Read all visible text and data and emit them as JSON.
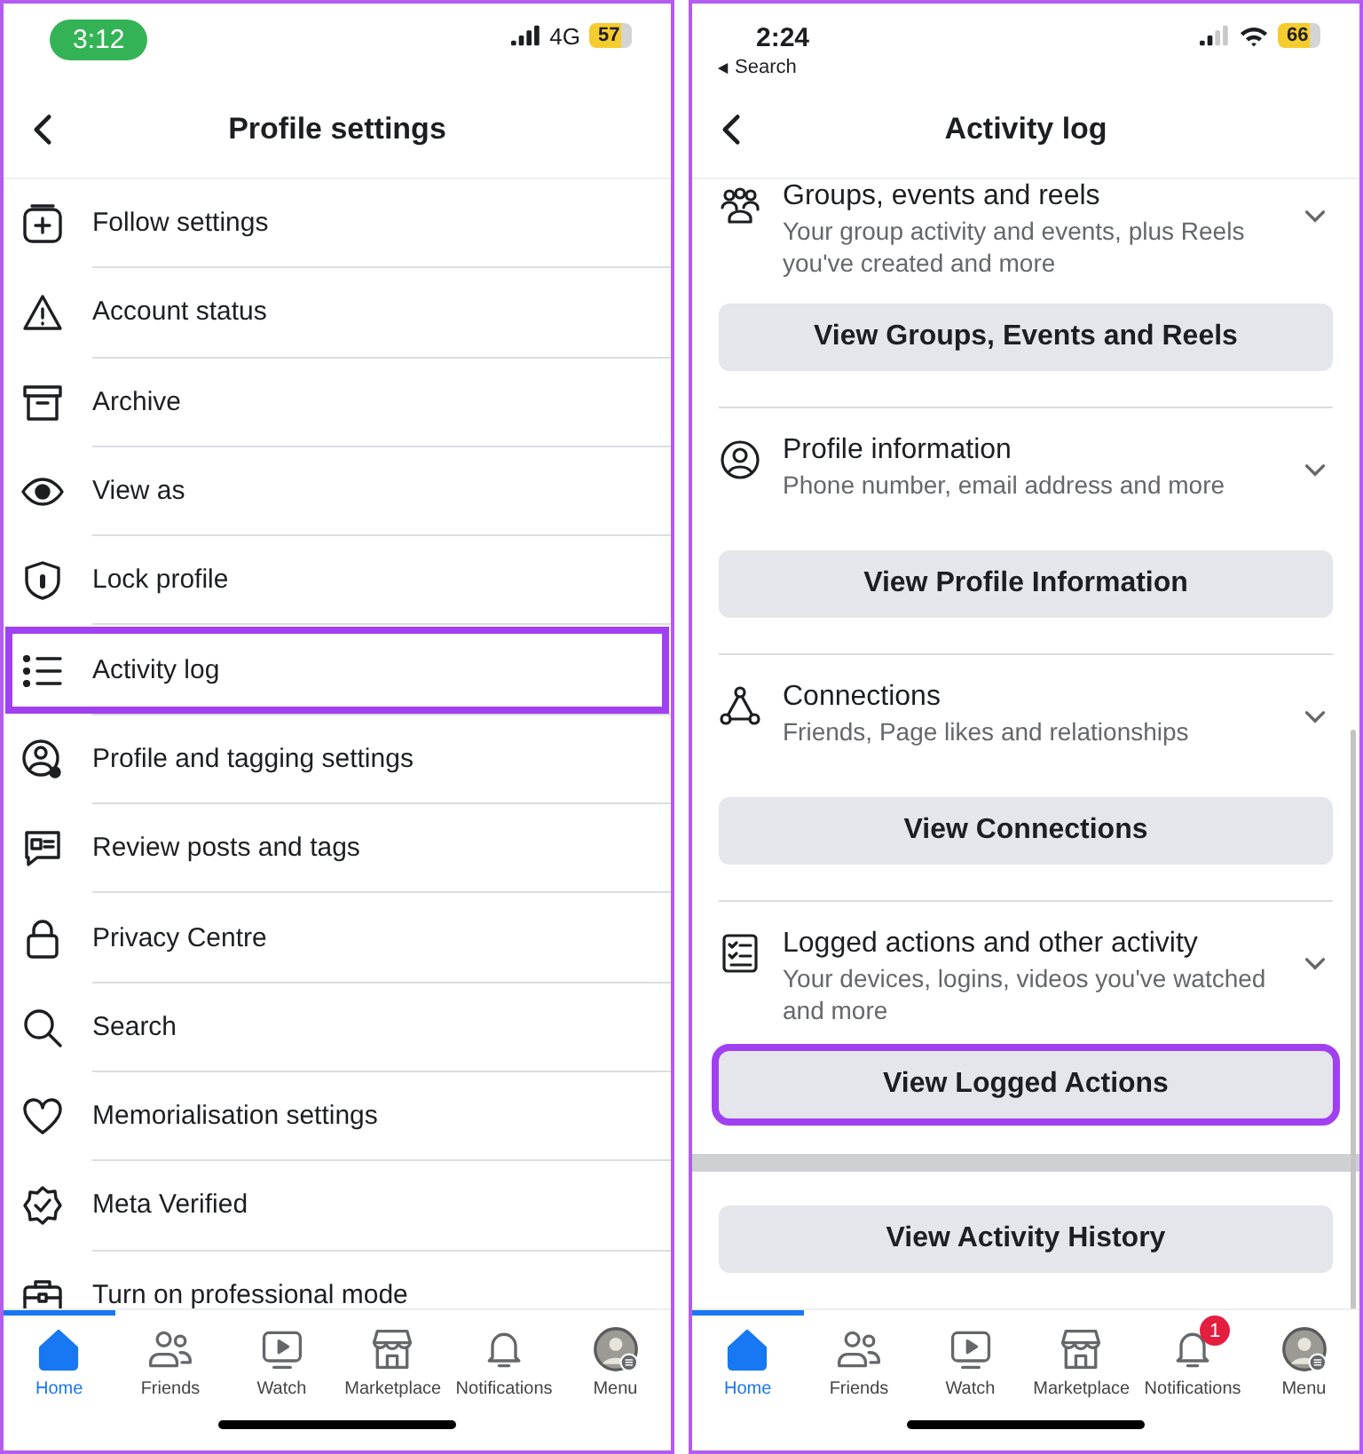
{
  "screens": [
    {
      "kind": "menu",
      "status_bar": {
        "time": "3:12",
        "call_active": true,
        "connection": {
          "kind": "cellular",
          "label": "4G"
        },
        "battery": "57"
      },
      "header": {
        "title": "Profile settings"
      },
      "items": [
        {
          "label": "Follow settings",
          "highlighted": false
        },
        {
          "label": "Account status",
          "highlighted": false
        },
        {
          "label": "Archive",
          "highlighted": false
        },
        {
          "label": "View as",
          "highlighted": false
        },
        {
          "label": "Lock profile",
          "highlighted": false
        },
        {
          "label": "Activity log",
          "highlighted": true
        },
        {
          "label": "Profile and tagging settings",
          "highlighted": false
        },
        {
          "label": "Review posts and tags",
          "highlighted": false
        },
        {
          "label": "Privacy Centre",
          "highlighted": false
        },
        {
          "label": "Search",
          "highlighted": false
        },
        {
          "label": "Memorialisation settings",
          "highlighted": false
        },
        {
          "label": "Meta Verified",
          "highlighted": false
        },
        {
          "label": "Turn on professional mode",
          "highlighted": false
        }
      ],
      "nav": [
        {
          "label": "Home",
          "selected": true
        },
        {
          "label": "Friends",
          "selected": false
        },
        {
          "label": "Watch",
          "selected": false
        },
        {
          "label": "Marketplace",
          "selected": false
        },
        {
          "label": "Notifications",
          "selected": false
        },
        {
          "label": "Menu",
          "selected": false
        }
      ]
    },
    {
      "kind": "sections",
      "status_bar": {
        "time": "2:24",
        "call_active": false,
        "back_link": "Search",
        "connection": {
          "kind": "wifi"
        },
        "battery": "66"
      },
      "header": {
        "title": "Activity log"
      },
      "sections": [
        {
          "title": "Groups, events and reels",
          "subtitle": "Your group activity and events, plus Reels you've created and more",
          "expanded": false,
          "button": "View Groups, Events and Reels",
          "highlighted": false
        },
        {
          "title": "Profile information",
          "subtitle": "Phone number, email address and more",
          "expanded": false,
          "button": "View Profile Information",
          "highlighted": false
        },
        {
          "title": "Connections",
          "subtitle": "Friends, Page likes and relationships",
          "expanded": false,
          "button": "View Connections",
          "highlighted": false
        },
        {
          "title": "Logged actions and other activity",
          "subtitle": "Your devices, logins, videos you've watched and more",
          "expanded": false,
          "button": "View Logged Actions",
          "highlighted": true
        }
      ],
      "footer_button": "View Activity History",
      "nav": [
        {
          "label": "Home",
          "selected": true
        },
        {
          "label": "Friends",
          "selected": false
        },
        {
          "label": "Watch",
          "selected": false
        },
        {
          "label": "Marketplace",
          "selected": false
        },
        {
          "label": "Notifications",
          "selected": false,
          "badge": "1"
        },
        {
          "label": "Menu",
          "selected": false
        }
      ]
    }
  ]
}
